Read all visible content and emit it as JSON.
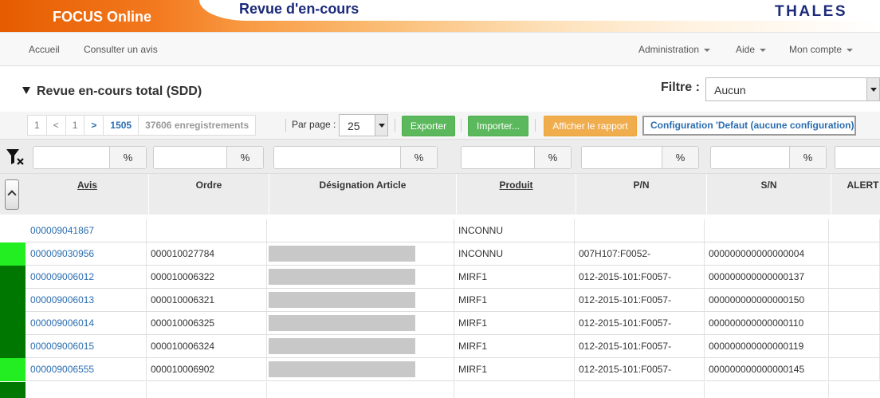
{
  "header": {
    "app_name": "FOCUS Online",
    "page_heading": "Revue d'en-cours",
    "company": "THALES"
  },
  "nav": {
    "left": [
      "Accueil",
      "Consulter un avis"
    ],
    "right": [
      "Administration",
      "Aide",
      "Mon compte"
    ]
  },
  "section": {
    "title": "Revue en-cours total (SDD)",
    "filter_label": "Filtre :",
    "filter_value": "Aucun"
  },
  "toolbar": {
    "pager": {
      "first": "1",
      "prev": "<",
      "current": "1",
      "next": ">",
      "last": "1505",
      "count": "37606 enregistrements"
    },
    "per_page_label": "Par page :",
    "per_page_value": "25",
    "export_label": "Exporter",
    "import_label": "Importer...",
    "report_label": "Afficher le rapport",
    "config_label": "Configuration 'Defaut (aucune configuration)'"
  },
  "filters": {
    "operator": "%"
  },
  "columns": [
    "Avis",
    "Ordre",
    "Désignation Article",
    "Produit",
    "P/N",
    "S/N",
    "ALERT"
  ],
  "rows": [
    {
      "status": "#ffffff",
      "avis": "000009041867",
      "ordre": "",
      "designation_redacted": false,
      "produit": "INCONNU",
      "pn": "",
      "sn": ""
    },
    {
      "status": "#22ee22",
      "avis": "000009030956",
      "ordre": "000010027784",
      "designation_redacted": true,
      "produit": "INCONNU",
      "pn": "007H107:F0052-",
      "sn": "000000000000000004"
    },
    {
      "status": "#007700",
      "avis": "000009006012",
      "ordre": "000010006322",
      "designation_redacted": true,
      "produit": "MIRF1",
      "pn": "012-2015-101:F0057-",
      "sn": "000000000000000137"
    },
    {
      "status": "#007700",
      "avis": "000009006013",
      "ordre": "000010006321",
      "designation_redacted": true,
      "produit": "MIRF1",
      "pn": "012-2015-101:F0057-",
      "sn": "000000000000000150"
    },
    {
      "status": "#007700",
      "avis": "000009006014",
      "ordre": "000010006325",
      "designation_redacted": true,
      "produit": "MIRF1",
      "pn": "012-2015-101:F0057-",
      "sn": "000000000000000110"
    },
    {
      "status": "#007700",
      "avis": "000009006015",
      "ordre": "000010006324",
      "designation_redacted": true,
      "produit": "MIRF1",
      "pn": "012-2015-101:F0057-",
      "sn": "000000000000000119"
    },
    {
      "status": "#22ee22",
      "avis": "000009006555",
      "ordre": "000010006902",
      "designation_redacted": true,
      "produit": "MIRF1",
      "pn": "012-2015-101:F0057-",
      "sn": "000000000000000145"
    }
  ],
  "colors": {
    "accent_orange": "#f37a1f",
    "brand_blue": "#1b2a7a",
    "link_blue": "#2a6db0",
    "status_light_green": "#22ee22",
    "status_dark_green": "#007700"
  },
  "icons": {
    "filter_clear": "filter-clear-icon",
    "collapse": "chevron-up-icon"
  }
}
